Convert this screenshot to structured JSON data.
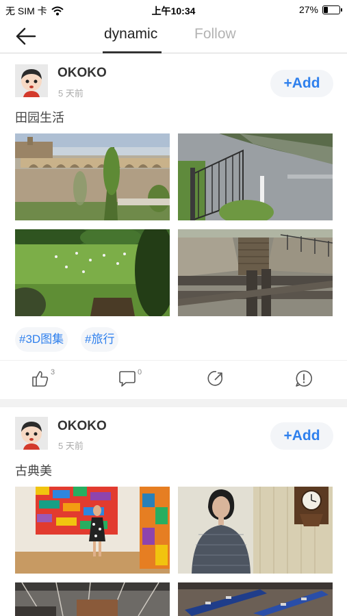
{
  "status_bar": {
    "carrier": "无 SIM 卡",
    "time": "上午10:34",
    "battery_percent": "27%",
    "battery_level": 0.27
  },
  "nav": {
    "tabs": [
      {
        "label": "dynamic",
        "active": true
      },
      {
        "label": "Follow",
        "active": false
      }
    ]
  },
  "posts": [
    {
      "username": "OKOKO",
      "time": "5 天前",
      "add_label": "+Add",
      "text": "田园生活",
      "tags": [
        "#3D图集",
        "#旅行"
      ],
      "likes": "3",
      "comments": "0"
    },
    {
      "username": "OKOKO",
      "time": "5 天前",
      "add_label": "+Add",
      "text": "古典美"
    }
  ],
  "colors": {
    "accent": "#2f80ed",
    "muted": "#aaaaaa",
    "divider": "#d6d6d6"
  },
  "icons": [
    "back-arrow-icon",
    "wifi-icon",
    "battery-icon",
    "like-icon",
    "comment-icon",
    "share-icon",
    "report-icon"
  ]
}
